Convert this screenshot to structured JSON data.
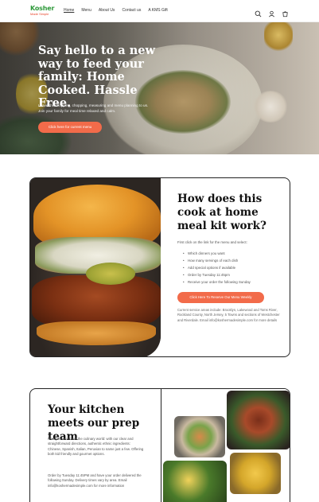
{
  "header": {
    "logo_text_top": "Kosher",
    "logo_text_bottom": "Made Simple",
    "nav": [
      "Home",
      "Menu",
      "About Us",
      "Contact us",
      "A KMS Gift"
    ],
    "icons": [
      "search-icon",
      "account-icon",
      "cart-icon"
    ]
  },
  "hero": {
    "title": "Say hello to a new way to feed your family: Home Cooked. Hassle Free.",
    "subtitle": "Leave the shopping, chopping, measuring and menu planning to us. Join your family for meal time relaxed and calm.",
    "button": "Click here for current menu"
  },
  "how": {
    "title": "How does this cook at home meal kit work?",
    "intro": "First click on the link for the menu and select:",
    "steps": [
      "Which dinners you want",
      "How many servings of each dish",
      "Add special options if available",
      "Order by Tuesday 11:45pm",
      "Receive your order the following Sunday"
    ],
    "button": "Click Here To Reserve Our Menu Weekly",
    "areas": "Current service areas include: Brooklyn, Lakewood and Toms River, Rockland County, North Jersey, 5 Towns and sections of Westchester and Riverdale. Email info@koshermadesimple.com for more details"
  },
  "kitchen": {
    "title": "Your kitchen meets our prep team",
    "p1": "Now you can travel the culinary world: with our clear and straightforward directions, authentic ethnic ingredients: Chinese, Spanish, Italian, Peruvian to name just a few. Offering both kid friendly and gourmet options.",
    "p2": "Order by Tuesday 11:45PM and have your order delivered the following Sunday. Delivery times vary by area. Email info@koshermadesimple.com for more information"
  },
  "colors": {
    "accent": "#f26b4a",
    "logo_green": "#2f9a3b",
    "logo_red": "#e8462c"
  }
}
